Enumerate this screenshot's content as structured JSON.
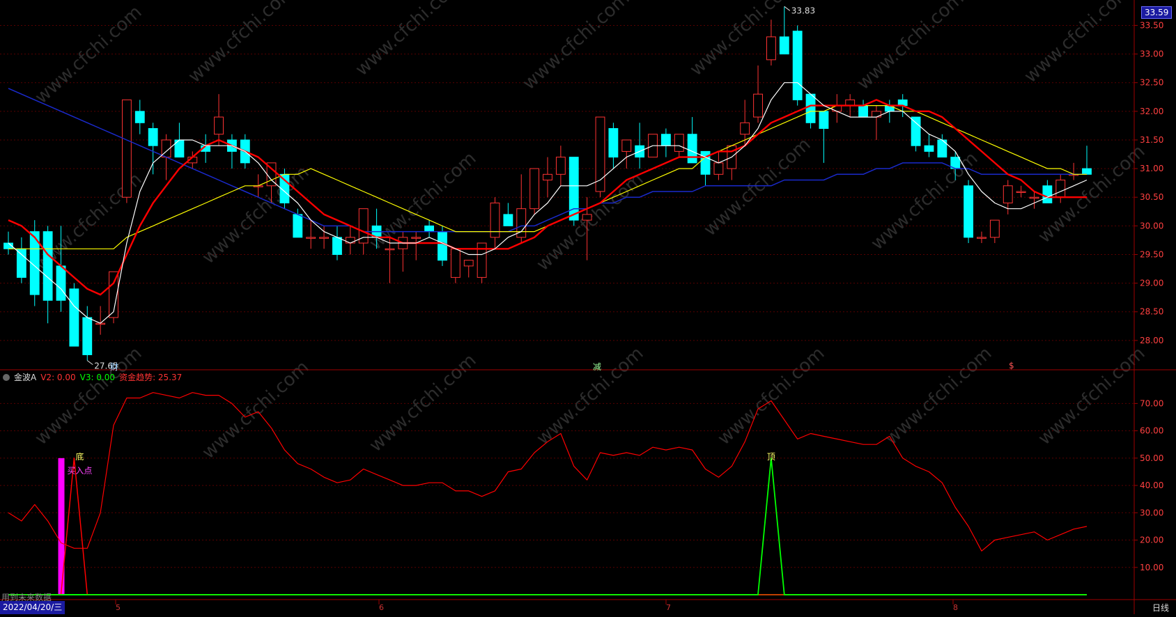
{
  "main_panel": {
    "price_high_marker": "33.83",
    "price_low_marker": "27.65",
    "current_price_badge": "33.59",
    "y_ticks": [
      "33.50",
      "33.00",
      "32.50",
      "32.00",
      "31.50",
      "31.00",
      "30.50",
      "30.00",
      "29.50",
      "29.00",
      "28.50",
      "28.00"
    ],
    "events": [
      {
        "label": "财",
        "color": "#9bd0ff"
      },
      {
        "label": "减",
        "color": "#9bff9b"
      },
      {
        "label": "$",
        "color": "#ff5555"
      }
    ],
    "watermark": "www.cfchi.com"
  },
  "indicator_panel": {
    "name": "金波A",
    "v2_label": "V2: 0.00",
    "v3_label": "V3: 0.00",
    "fund_trend_label": "资金趋势: 25.37",
    "y_ticks": [
      "70.00",
      "60.00",
      "50.00",
      "40.00",
      "30.00",
      "20.00",
      "10.00"
    ],
    "signal_bottom": "底",
    "signal_buy": "买入点",
    "signal_top": "顶",
    "future_data_warning": "用到未来数据"
  },
  "x_axis": {
    "date_badge": "2022/04/20/三",
    "month_labels": [
      "5",
      "6",
      "7",
      "8"
    ],
    "period": "日线"
  },
  "colors": {
    "up": "#ff3333",
    "down": "#00ffff",
    "ma_white": "#ffffff",
    "ma_red": "#ff0000",
    "ma_yellow": "#ffff00",
    "ma_blue": "#1a2acc",
    "fund_trend": "#ff0000",
    "top_signal": "#00ff00",
    "buy_bar": "#ff00ff"
  },
  "chart_data": [
    {
      "type": "candlestick",
      "title": "",
      "ylim": [
        27.5,
        33.7
      ],
      "series_ohlc": [
        [
          29.7,
          29.9,
          29.5,
          29.6
        ],
        [
          29.6,
          29.8,
          29.0,
          29.1
        ],
        [
          29.9,
          30.1,
          28.6,
          28.8
        ],
        [
          29.9,
          30.0,
          28.3,
          28.7
        ],
        [
          29.3,
          30.0,
          28.5,
          28.7
        ],
        [
          28.9,
          29.0,
          27.9,
          27.9
        ],
        [
          28.4,
          28.6,
          27.65,
          27.75
        ],
        [
          28.3,
          28.6,
          28.1,
          28.3
        ],
        [
          28.4,
          29.2,
          28.3,
          29.2
        ],
        [
          30.5,
          32.2,
          30.4,
          32.2
        ],
        [
          32.0,
          32.2,
          31.6,
          31.8
        ],
        [
          31.7,
          31.8,
          30.9,
          31.4
        ],
        [
          31.2,
          31.6,
          30.8,
          31.5
        ],
        [
          31.5,
          31.8,
          31.2,
          31.2
        ],
        [
          31.1,
          31.3,
          31.0,
          31.2
        ],
        [
          31.4,
          31.6,
          31.1,
          31.3
        ],
        [
          31.6,
          32.3,
          31.4,
          31.9
        ],
        [
          31.5,
          31.6,
          31.0,
          31.3
        ],
        [
          31.5,
          31.6,
          31.0,
          31.1
        ],
        [
          30.7,
          30.9,
          30.5,
          30.7
        ],
        [
          30.7,
          31.1,
          30.4,
          31.1
        ],
        [
          30.9,
          31.0,
          30.3,
          30.4
        ],
        [
          30.2,
          30.3,
          29.8,
          29.8
        ],
        [
          29.8,
          30.1,
          29.6,
          29.8
        ],
        [
          29.8,
          30.0,
          29.6,
          29.8
        ],
        [
          29.8,
          30.0,
          29.4,
          29.5
        ],
        [
          29.7,
          30.0,
          29.5,
          29.8
        ],
        [
          29.7,
          30.3,
          29.5,
          30.3
        ],
        [
          30.0,
          30.3,
          29.6,
          29.8
        ],
        [
          29.6,
          29.8,
          29.0,
          29.6
        ],
        [
          29.6,
          29.9,
          29.2,
          29.8
        ],
        [
          29.8,
          29.9,
          29.4,
          29.8
        ],
        [
          30.0,
          30.1,
          29.8,
          29.9
        ],
        [
          29.9,
          30.0,
          29.3,
          29.4
        ],
        [
          29.1,
          29.6,
          29.0,
          29.6
        ],
        [
          29.3,
          29.4,
          29.1,
          29.4
        ],
        [
          29.1,
          29.7,
          29.0,
          29.7
        ],
        [
          29.8,
          30.5,
          29.6,
          30.4
        ],
        [
          30.2,
          30.4,
          30.0,
          30.0
        ],
        [
          29.8,
          30.9,
          29.7,
          30.3
        ],
        [
          30.3,
          31.0,
          30.2,
          31.0
        ],
        [
          30.8,
          31.2,
          30.5,
          30.9
        ],
        [
          30.9,
          31.4,
          30.7,
          31.2
        ],
        [
          31.2,
          31.2,
          30.0,
          30.1
        ],
        [
          30.1,
          30.5,
          29.4,
          30.2
        ],
        [
          30.6,
          31.8,
          30.5,
          31.9
        ],
        [
          31.7,
          31.8,
          31.0,
          31.2
        ],
        [
          31.3,
          31.5,
          31.0,
          31.5
        ],
        [
          31.4,
          31.8,
          31.0,
          31.2
        ],
        [
          31.2,
          31.6,
          31.2,
          31.6
        ],
        [
          31.6,
          31.7,
          31.2,
          31.4
        ],
        [
          31.3,
          31.6,
          31.2,
          31.6
        ],
        [
          31.6,
          31.9,
          31.2,
          31.1
        ],
        [
          31.3,
          31.3,
          30.7,
          30.9
        ],
        [
          30.9,
          31.3,
          30.8,
          31.1
        ],
        [
          31.0,
          31.4,
          30.8,
          31.4
        ],
        [
          31.6,
          32.2,
          31.4,
          31.8
        ],
        [
          31.9,
          32.8,
          31.8,
          32.3
        ],
        [
          32.9,
          33.6,
          32.8,
          33.3
        ],
        [
          33.3,
          33.83,
          33.0,
          33.0
        ],
        [
          33.4,
          33.5,
          32.1,
          32.2
        ],
        [
          32.3,
          32.3,
          31.7,
          31.8
        ],
        [
          32.0,
          32.0,
          31.1,
          31.7
        ],
        [
          32.0,
          32.3,
          31.8,
          32.1
        ],
        [
          32.1,
          32.3,
          31.9,
          32.2
        ],
        [
          32.1,
          32.2,
          31.9,
          31.9
        ],
        [
          31.9,
          32.1,
          31.5,
          32.0
        ],
        [
          32.1,
          32.2,
          31.8,
          32.0
        ],
        [
          32.2,
          32.3,
          31.9,
          32.1
        ],
        [
          31.9,
          31.9,
          31.3,
          31.4
        ],
        [
          31.4,
          31.6,
          31.2,
          31.3
        ],
        [
          31.5,
          31.6,
          31.2,
          31.2
        ],
        [
          31.2,
          31.3,
          30.8,
          31.0
        ],
        [
          30.7,
          30.8,
          29.7,
          29.8
        ],
        [
          29.8,
          29.9,
          29.7,
          29.8
        ],
        [
          29.8,
          30.1,
          29.7,
          30.1
        ],
        [
          30.4,
          30.8,
          30.2,
          30.7
        ],
        [
          30.6,
          30.7,
          30.5,
          30.6
        ],
        [
          30.5,
          30.6,
          30.3,
          30.5
        ],
        [
          30.7,
          30.8,
          30.4,
          30.4
        ],
        [
          30.5,
          30.9,
          30.4,
          30.8
        ],
        [
          30.9,
          31.1,
          30.8,
          30.9
        ],
        [
          31.0,
          31.4,
          30.9,
          30.9
        ]
      ],
      "ma_white": [
        29.7,
        29.5,
        29.3,
        29.1,
        28.9,
        28.6,
        28.4,
        28.3,
        28.5,
        29.7,
        30.6,
        31.1,
        31.3,
        31.5,
        31.5,
        31.4,
        31.4,
        31.4,
        31.3,
        31.1,
        30.8,
        30.6,
        30.4,
        30.1,
        29.9,
        29.8,
        29.7,
        29.8,
        29.8,
        29.7,
        29.7,
        29.7,
        29.8,
        29.7,
        29.6,
        29.5,
        29.5,
        29.6,
        29.8,
        29.9,
        30.2,
        30.4,
        30.7,
        30.7,
        30.7,
        30.8,
        31.0,
        31.2,
        31.3,
        31.4,
        31.4,
        31.4,
        31.3,
        31.2,
        31.1,
        31.2,
        31.4,
        31.7,
        32.2,
        32.5,
        32.5,
        32.3,
        32.1,
        32.0,
        31.9,
        31.9,
        31.9,
        32.0,
        32.0,
        31.8,
        31.6,
        31.5,
        31.3,
        30.9,
        30.6,
        30.4,
        30.3,
        30.3,
        30.4,
        30.5,
        30.6,
        30.7,
        30.8
      ],
      "ma_red": [
        30.1,
        30.0,
        29.8,
        29.5,
        29.3,
        29.1,
        28.9,
        28.8,
        29.0,
        29.5,
        30.0,
        30.4,
        30.7,
        31.0,
        31.2,
        31.4,
        31.5,
        31.4,
        31.3,
        31.2,
        31.0,
        30.8,
        30.6,
        30.4,
        30.2,
        30.1,
        30.0,
        29.9,
        29.8,
        29.8,
        29.7,
        29.7,
        29.7,
        29.7,
        29.6,
        29.6,
        29.6,
        29.6,
        29.6,
        29.7,
        29.8,
        30.0,
        30.1,
        30.2,
        30.3,
        30.4,
        30.6,
        30.8,
        30.9,
        31.0,
        31.1,
        31.2,
        31.2,
        31.2,
        31.3,
        31.3,
        31.4,
        31.6,
        31.8,
        31.9,
        32.0,
        32.1,
        32.1,
        32.1,
        32.1,
        32.1,
        32.2,
        32.1,
        32.1,
        32.0,
        32.0,
        31.9,
        31.7,
        31.5,
        31.3,
        31.1,
        30.9,
        30.8,
        30.6,
        30.5,
        30.5,
        30.5,
        30.5
      ],
      "ma_yellow": [
        29.6,
        29.6,
        29.6,
        29.6,
        29.6,
        29.6,
        29.6,
        29.6,
        29.6,
        29.8,
        29.9,
        30.0,
        30.1,
        30.2,
        30.3,
        30.4,
        30.5,
        30.6,
        30.7,
        30.7,
        30.8,
        30.9,
        30.9,
        31.0,
        30.9,
        30.8,
        30.7,
        30.6,
        30.5,
        30.4,
        30.3,
        30.2,
        30.1,
        30.0,
        29.9,
        29.9,
        29.9,
        29.9,
        29.9,
        29.9,
        29.9,
        30.0,
        30.1,
        30.2,
        30.3,
        30.4,
        30.5,
        30.6,
        30.7,
        30.8,
        30.9,
        31.0,
        31.0,
        31.2,
        31.3,
        31.4,
        31.5,
        31.6,
        31.7,
        31.8,
        31.9,
        32.0,
        32.0,
        32.1,
        32.1,
        32.1,
        32.1,
        32.1,
        32.0,
        32.0,
        31.9,
        31.8,
        31.7,
        31.6,
        31.5,
        31.4,
        31.3,
        31.2,
        31.1,
        31.0,
        31.0,
        30.9,
        30.9
      ],
      "ma_blue": [
        32.4,
        32.3,
        32.2,
        32.1,
        32.0,
        31.9,
        31.8,
        31.7,
        31.6,
        31.5,
        31.4,
        31.3,
        31.2,
        31.1,
        31.0,
        30.9,
        30.8,
        30.7,
        30.6,
        30.5,
        30.4,
        30.3,
        30.2,
        30.1,
        30.0,
        30.0,
        30.0,
        29.9,
        29.9,
        29.9,
        29.9,
        29.9,
        29.9,
        29.9,
        29.9,
        29.9,
        29.9,
        29.9,
        29.9,
        30.0,
        30.0,
        30.1,
        30.2,
        30.3,
        30.3,
        30.4,
        30.4,
        30.5,
        30.5,
        30.6,
        30.6,
        30.6,
        30.6,
        30.7,
        30.7,
        30.7,
        30.7,
        30.7,
        30.7,
        30.8,
        30.8,
        30.8,
        30.8,
        30.9,
        30.9,
        30.9,
        31.0,
        31.0,
        31.1,
        31.1,
        31.1,
        31.1,
        31.0,
        31.0,
        30.9,
        30.9,
        30.9,
        30.9,
        30.9,
        30.9,
        30.9,
        30.9,
        30.9
      ]
    },
    {
      "type": "line",
      "title": "",
      "ylim": [
        0,
        78
      ],
      "series": [
        {
          "name": "资金趋势",
          "values": [
            30,
            27,
            33,
            27,
            19,
            17,
            17,
            30,
            62,
            72,
            72,
            74,
            73,
            72,
            74,
            73,
            73,
            70,
            65,
            67,
            61,
            53,
            48,
            46,
            43,
            41,
            42,
            46,
            44,
            42,
            40,
            40,
            41,
            41,
            38,
            38,
            36,
            38,
            45,
            46,
            52,
            56,
            59,
            47,
            42,
            52,
            51,
            52,
            51,
            54,
            53,
            54,
            53,
            46,
            43,
            47,
            56,
            68,
            71,
            64,
            57,
            59,
            58,
            57,
            56,
            55,
            55,
            58,
            50,
            47,
            45,
            41,
            32,
            25,
            16,
            20,
            21,
            22,
            23,
            20,
            22,
            24,
            25
          ]
        },
        {
          "name": "顶",
          "values": [
            0,
            0,
            0,
            0,
            0,
            0,
            0,
            0,
            0,
            0,
            0,
            0,
            0,
            0,
            0,
            0,
            0,
            0,
            0,
            0,
            0,
            0,
            0,
            0,
            0,
            0,
            0,
            0,
            0,
            0,
            0,
            0,
            0,
            0,
            0,
            0,
            0,
            0,
            0,
            0,
            0,
            0,
            0,
            0,
            0,
            0,
            0,
            0,
            0,
            0,
            0,
            0,
            0,
            0,
            0,
            0,
            0,
            0,
            50,
            0,
            0,
            0,
            0,
            0,
            0,
            0,
            0,
            0,
            0,
            0,
            0,
            0,
            0,
            0,
            0,
            0,
            0,
            0,
            0,
            0,
            0,
            0,
            0
          ]
        },
        {
          "name": "底",
          "values": [
            0,
            0,
            0,
            0,
            0,
            50,
            0,
            0,
            0,
            0,
            0,
            0,
            0,
            0,
            0,
            0,
            0,
            0,
            0,
            0,
            0,
            0,
            0,
            0,
            0,
            0,
            0,
            0,
            0,
            0,
            0,
            0,
            0,
            0,
            0,
            0,
            0,
            0,
            0,
            0,
            0,
            0,
            0,
            0,
            0,
            0,
            0,
            0,
            0,
            0,
            0,
            0,
            0,
            0,
            0,
            0,
            0,
            0,
            0,
            0,
            0,
            0,
            0,
            0,
            0,
            0,
            0,
            0,
            0,
            0,
            0,
            0,
            0,
            0,
            0,
            0,
            0,
            0,
            0,
            0,
            0,
            0,
            0
          ]
        }
      ]
    }
  ]
}
